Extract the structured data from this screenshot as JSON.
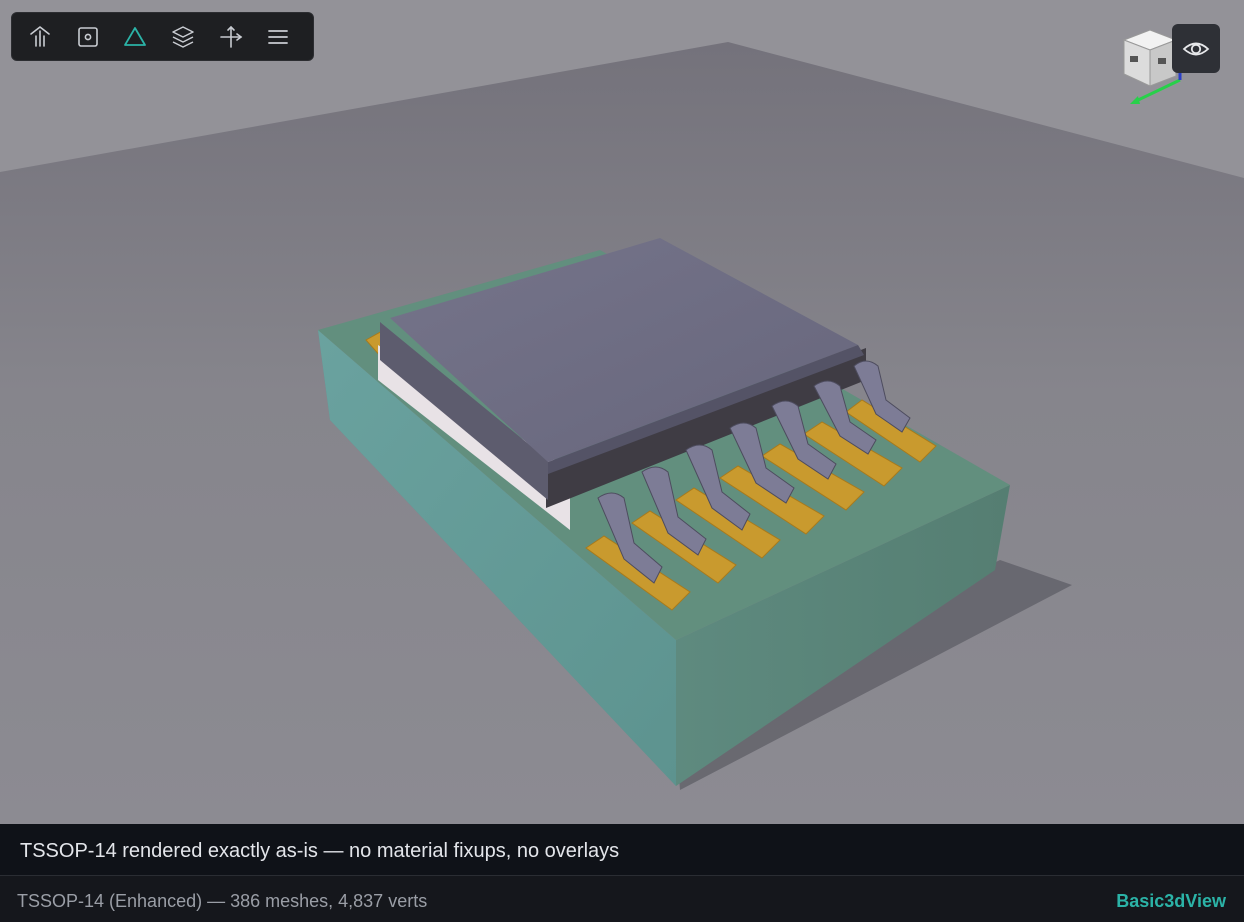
{
  "toolbar": {
    "buttons": [
      {
        "icon": "home-icon",
        "active": false
      },
      {
        "icon": "camera-frame-icon",
        "active": false
      },
      {
        "icon": "triangle-icon",
        "active": true
      },
      {
        "icon": "layers-icon",
        "active": false
      },
      {
        "icon": "axis-icon",
        "active": false
      },
      {
        "icon": "menu-icon",
        "active": false
      }
    ],
    "accent_color": "#2bb3a7",
    "icon_color": "#c9ccd2"
  },
  "view_cube": {
    "icon": "view-cube-icon"
  },
  "visibility_button": {
    "icon": "eye-icon"
  },
  "caption": {
    "text": "TSSOP-14 rendered exactly as-is — no material fixups, no overlays"
  },
  "status": {
    "summary": "TSSOP-14 (Enhanced) — 386 meshes, 4,837 verts",
    "brand": "Basic3dView"
  },
  "colors": {
    "board": "#5f9a8f",
    "pads": "#c99a2e",
    "package_body": "#6e6d84",
    "pins": "#7d7c96"
  }
}
